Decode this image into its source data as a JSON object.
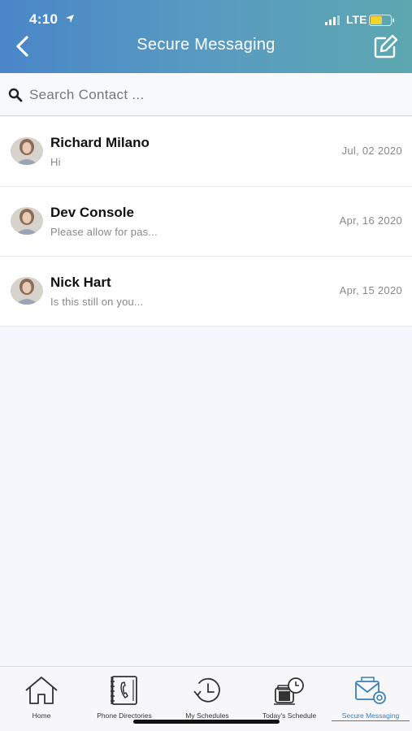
{
  "status_bar": {
    "time": "4:10",
    "network": "LTE",
    "battery_color": "#f2d22f"
  },
  "nav": {
    "title": "Secure Messaging",
    "back_icon": "chevron-left-icon",
    "compose_icon": "compose-icon"
  },
  "search": {
    "placeholder": "Search Contact ...",
    "value": ""
  },
  "conversations": [
    {
      "name": "Richard Milano",
      "preview": "Hi",
      "date": "Jul, 02 2020"
    },
    {
      "name": "Dev Console",
      "preview": "Please allow for pas...",
      "date": "Apr, 16 2020"
    },
    {
      "name": "Nick Hart",
      "preview": "Is this still on you...",
      "date": "Apr, 15 2020"
    }
  ],
  "tabs": [
    {
      "label": "Home",
      "icon": "home-icon"
    },
    {
      "label": "Phone Directories",
      "icon": "phone-directory-icon"
    },
    {
      "label": "My Schedules",
      "icon": "schedule-history-icon"
    },
    {
      "label": "Today's Schedule",
      "icon": "todays-schedule-icon"
    },
    {
      "label": "Secure Messaging",
      "icon": "secure-message-icon",
      "active": true
    }
  ],
  "colors": {
    "header_gradient_start": "#4a86c8",
    "header_gradient_end": "#5ca7b0",
    "active_tab": "#3a7fb8"
  }
}
